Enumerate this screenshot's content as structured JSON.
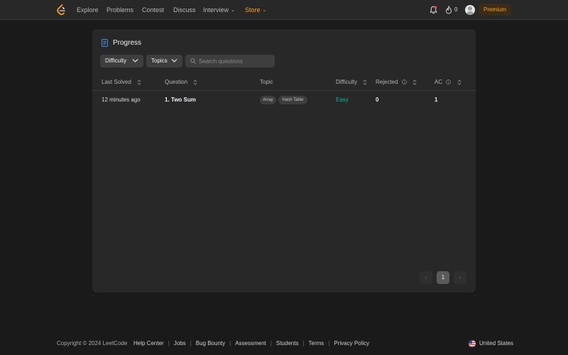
{
  "nav": {
    "links": [
      {
        "label": "Explore"
      },
      {
        "label": "Problems"
      },
      {
        "label": "Contest"
      },
      {
        "label": "Discuss"
      },
      {
        "label": "Interview"
      },
      {
        "label": "Store"
      }
    ],
    "streak_count": "0",
    "premium_label": "Premium"
  },
  "card": {
    "title": "Progress",
    "filters": {
      "difficulty_label": "Difficulty",
      "topics_label": "Topics",
      "search_placeholder": "Search questions",
      "search_value": ""
    },
    "table": {
      "columns": [
        "Last Solved",
        "Question",
        "Topic",
        "Difficulty",
        "Rejected",
        "AC"
      ],
      "rows": [
        {
          "last_solved": "12 minutes ago",
          "question": "1. Two Sum",
          "topics": [
            "Array",
            "Hash Table"
          ],
          "difficulty": "Easy",
          "rejected": "0",
          "ac": "1"
        }
      ]
    },
    "pagination": {
      "prev": "‹",
      "current": "1",
      "next": "›"
    }
  },
  "footer": {
    "copyright": "Copyright © 2024 LeetCode",
    "links": [
      "Help Center",
      "Jobs",
      "Bug Bounty",
      "Assessment",
      "Students",
      "Terms",
      "Privacy Policy"
    ],
    "country": "United States"
  },
  "colors": {
    "accent": "#ffa116",
    "easy": "#00b8a3",
    "background": "#1a1a1a",
    "card": "#282828"
  },
  "icons": {
    "logo": "leetcode-logo-icon",
    "bell": "bell-icon",
    "fire": "fire-icon",
    "avatar": "avatar",
    "title": "document-icon",
    "search": "search-icon",
    "sort": "sort-icon",
    "info": "info-icon",
    "flag": "us-flag-icon"
  }
}
